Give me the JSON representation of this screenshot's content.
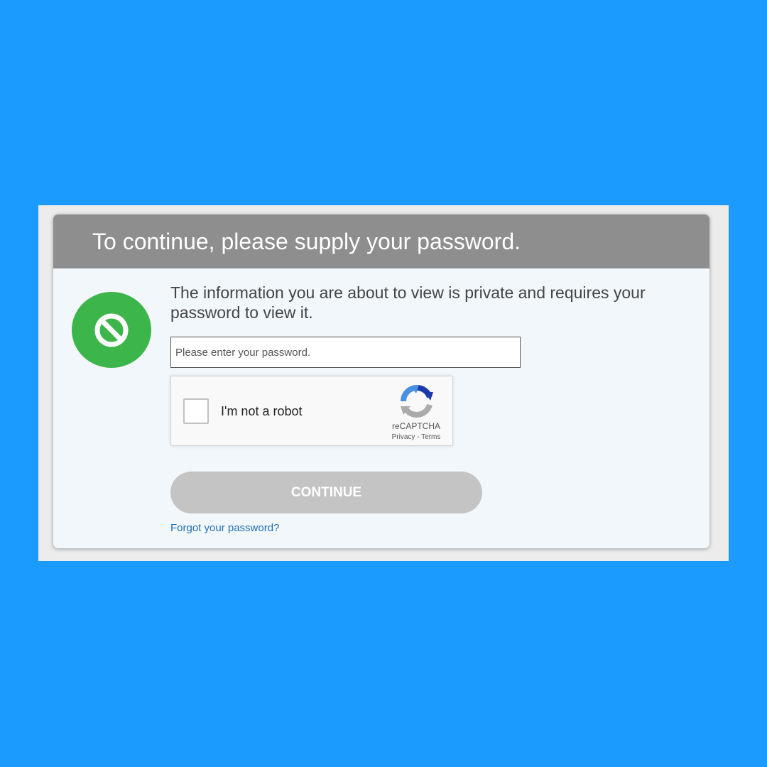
{
  "dialog": {
    "title": "To continue, please supply your password.",
    "message": "The information you are about to view is private and requires your password to view it.",
    "icon": "blocked-icon",
    "password_placeholder": "Please enter your password.",
    "continue_label": "CONTINUE",
    "forgot_label": "Forgot your password?"
  },
  "recaptcha": {
    "checkbox_label": "I'm not a robot",
    "brand": "reCAPTCHA",
    "privacy": "Privacy",
    "separator": "-",
    "terms": "Terms",
    "icon": "recaptcha-logo-icon"
  },
  "colors": {
    "background": "#1b9bfd",
    "header": "#8e8e8e",
    "icon_green": "#3cb64a",
    "button_disabled": "#c4c4c4",
    "link": "#1f6fb5"
  }
}
